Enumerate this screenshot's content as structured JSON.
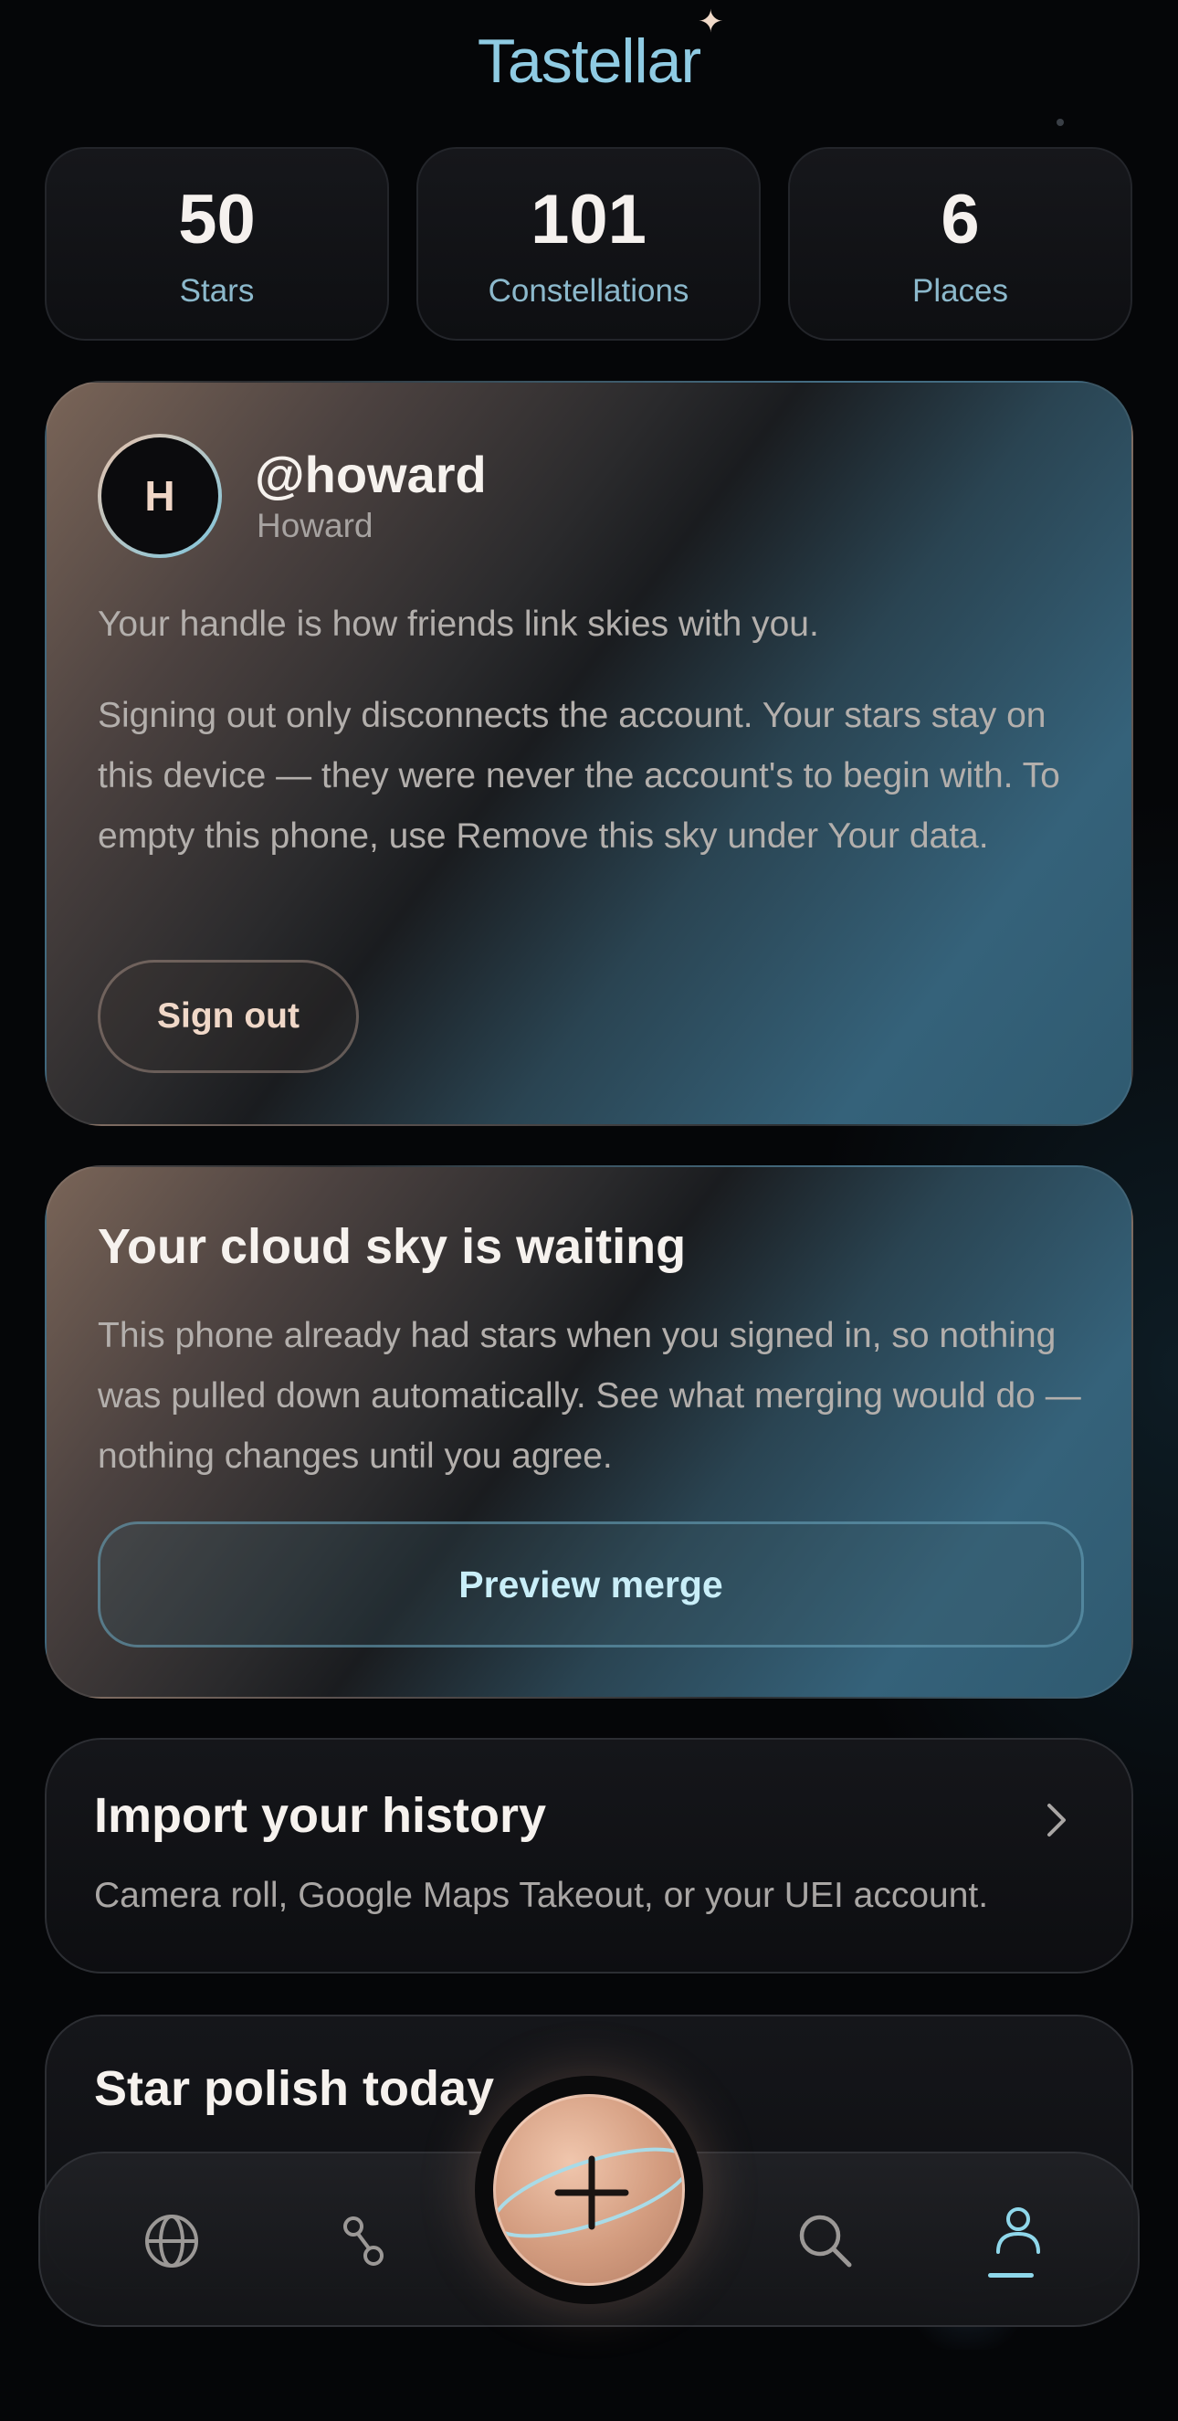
{
  "app": {
    "title": "Tastellar"
  },
  "stats": [
    {
      "value": "50",
      "label": "Stars"
    },
    {
      "value": "101",
      "label": "Constellations"
    },
    {
      "value": "6",
      "label": "Places"
    }
  ],
  "account": {
    "avatar_initial": "H",
    "handle": "@howard",
    "display_name": "Howard",
    "handle_hint": "Your handle is how friends link skies with you.",
    "signout_note": "Signing out only disconnects the account. Your stars stay on this device — they were never the account's to begin with. To empty this phone, use Remove this sky under Your data.",
    "signout_label": "Sign out"
  },
  "cloud": {
    "title": "Your cloud sky is waiting",
    "body": "This phone already had stars when you signed in, so nothing was pulled down automatically. See what merging would do — nothing changes until you agree.",
    "button_label": "Preview merge"
  },
  "import": {
    "title": "Import your history",
    "subtitle": "Camera roll, Google Maps Takeout, or your UEI account.",
    "icon": "chevron-right-icon"
  },
  "polish": {
    "title": "Star polish today"
  },
  "nav": {
    "items": [
      {
        "icon": "globe-icon",
        "active": false
      },
      {
        "icon": "constellation-icon",
        "active": false
      },
      {
        "icon": "add-star-icon",
        "active": false
      },
      {
        "icon": "search-icon",
        "active": false
      },
      {
        "icon": "profile-icon",
        "active": true
      }
    ]
  },
  "colors": {
    "accent": "#8fcbe3",
    "peach": "#e7bca4",
    "background": "#050608"
  }
}
